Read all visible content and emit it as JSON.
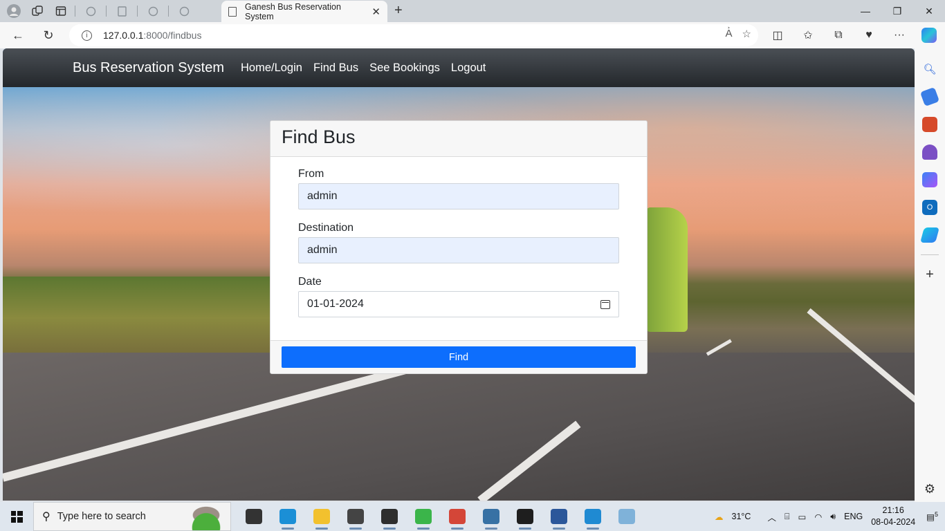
{
  "browser": {
    "tab_title": "Ganesh Bus Reservation System",
    "url_host": "127.0.0.1",
    "url_rest": ":8000/findbus",
    "icons": [
      "profile-icon",
      "workspaces-icon",
      "tab-actions-icon",
      "back-icon",
      "refresh-icon",
      "info-icon",
      "read-aloud-icon",
      "favorite-icon",
      "split-screen-icon",
      "favorites-icon",
      "collections-icon",
      "health-icon",
      "more-icon",
      "copilot-icon"
    ]
  },
  "sidebar": {
    "icons": [
      "search-icon",
      "shopping-icon",
      "tools-icon",
      "games-icon",
      "microsoft365-icon",
      "outlook-icon",
      "drop-icon",
      "add-icon",
      "settings-icon"
    ]
  },
  "site": {
    "brand": "Bus Reservation System",
    "nav": [
      {
        "label": "Home/Login"
      },
      {
        "label": "Find Bus"
      },
      {
        "label": "See Bookings"
      },
      {
        "label": "Logout"
      }
    ]
  },
  "form": {
    "title": "Find Bus",
    "from_label": "From",
    "from_value": "admin",
    "destination_label": "Destination",
    "destination_value": "admin",
    "date_label": "Date",
    "date_value": "01-01-2024",
    "submit_label": "Find"
  },
  "taskbar": {
    "search_placeholder": "Type here to search",
    "weather": "31°C",
    "lang": "ENG",
    "time": "21:16",
    "date": "08-04-2024",
    "notifications": "5",
    "apps": [
      {
        "name": "task-view",
        "color": "#333"
      },
      {
        "name": "edge",
        "color": "#1b8fd6"
      },
      {
        "name": "file-explorer",
        "color": "#f2c12e"
      },
      {
        "name": "mail",
        "color": "#444"
      },
      {
        "name": "terminal-app",
        "color": "#2e2e2e"
      },
      {
        "name": "circle-app",
        "color": "#3bb54a"
      },
      {
        "name": "chrome",
        "color": "#d44638"
      },
      {
        "name": "python",
        "color": "#3771a4"
      },
      {
        "name": "cmd",
        "color": "#1e1e1e"
      },
      {
        "name": "word",
        "color": "#2b579a"
      },
      {
        "name": "vscode",
        "color": "#1f8ad2"
      },
      {
        "name": "notes-app",
        "color": "#7fb2d9"
      }
    ]
  }
}
